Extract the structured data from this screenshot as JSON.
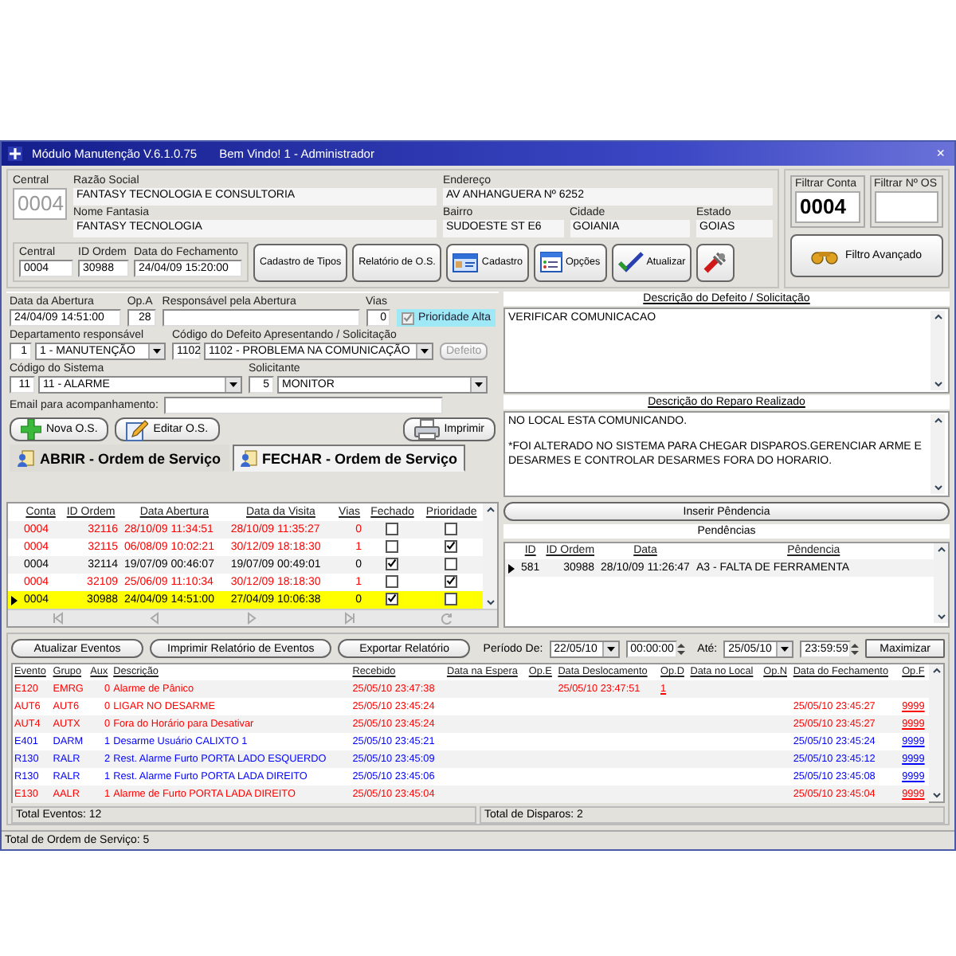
{
  "window": {
    "title": "Módulo Manutenção V.6.1.0.75",
    "welcome": "Bem Vindo! 1 - Administrador",
    "close": "×"
  },
  "client": {
    "central": {
      "label": "Central",
      "value": "0004",
      "disabled": true
    },
    "razao_social": {
      "label": "Razão Social",
      "value": "FANTASY TECNOLOGIA E CONSULTORIA"
    },
    "nome_fantasia": {
      "label": "Nome Fantasia",
      "value": "FANTASY TECNOLOGIA"
    },
    "endereco": {
      "label": "Endereço",
      "value": "AV ANHANGUERA  Nº 6252"
    },
    "bairro": {
      "label": "Bairro",
      "value": "SUDOESTE ST E6"
    },
    "cidade": {
      "label": "Cidade",
      "value": "GOIANIA"
    },
    "estado": {
      "label": "Estado",
      "value": "GOIAS"
    }
  },
  "order": {
    "central": {
      "label": "Central",
      "value": "0004"
    },
    "id_ordem": {
      "label": "ID Ordem",
      "value": "30988"
    },
    "data_fechamento": {
      "label": "Data do Fechamento",
      "value": "24/04/09 15:20:00"
    }
  },
  "toolbar": [
    {
      "kind": "text",
      "label": "Cadastro de Tipos"
    },
    {
      "kind": "text",
      "label": "Relatório de O.S."
    },
    {
      "kind": "card",
      "label": "Cadastro"
    },
    {
      "kind": "options",
      "label": "Opções"
    },
    {
      "kind": "check",
      "label": "Atualizar"
    },
    {
      "kind": "tools"
    }
  ],
  "filters": {
    "conta": {
      "label": "Filtrar Conta",
      "value": "0004"
    },
    "os": {
      "label": "Filtrar Nº OS"
    },
    "advanced": "Filtro Avançado"
  },
  "form": {
    "data_abertura": {
      "label": "Data da Abertura",
      "value": "24/04/09 14:51:00"
    },
    "op_a": {
      "label": "Op.A",
      "value": "28"
    },
    "responsavel": {
      "label": "Responsável pela Abertura"
    },
    "vias": {
      "label": "Vias",
      "value": "0"
    },
    "prioridade": {
      "label": "Prioridade Alta",
      "checked": true,
      "disabled": true
    },
    "departamento": {
      "label": "Departamento responsável",
      "code": "1",
      "value": "1 - MANUTENÇÃO"
    },
    "defeito": {
      "label": "Código do Defeito Apresentando / Solicitação",
      "code": "1102",
      "value": "1102 - PROBLEMA NA COMUNICAÇÃO"
    },
    "defeito_button": {
      "label": "Defeito",
      "disabled": true
    },
    "sistema": {
      "label": "Código do Sistema",
      "code": "11",
      "value": "11 - ALARME"
    },
    "solicitante": {
      "label": "Solicitante",
      "code": "5",
      "value": "MONITOR"
    },
    "email": {
      "label": "Email para acompanhamento:"
    },
    "actions": [
      {
        "kind": "new",
        "label": "Nova O.S."
      },
      {
        "kind": "edit",
        "label": "Editar O.S."
      },
      {
        "kind": "print",
        "label": "Imprimir"
      }
    ]
  },
  "tabs": [
    {
      "label": "ABRIR - Ordem de Serviço",
      "selected": false
    },
    {
      "label": "FECHAR - Ordem de Serviço",
      "selected": true
    }
  ],
  "defect_description": {
    "label": "Descrição do Defeito / Solicitação",
    "text": "VERIFICAR COMUNICACAO"
  },
  "repair_description": {
    "label": "Descrição do Reparo Realizado",
    "paragraphs": [
      "NO LOCAL ESTA COMUNICANDO.",
      "*FOI ALTERADO NO SISTEMA PARA CHEGAR DISPAROS.GERENCIAR ARME E DESARMES E CONTROLAR DESARMES FORA DO HORARIO."
    ]
  },
  "orders": {
    "columns": [
      "Conta",
      "ID Ordem",
      "Data Abertura",
      "Data da Visita",
      "Vias",
      "Fechado",
      "Prioridade"
    ],
    "rows": [
      {
        "conta": "0004",
        "id": "32116",
        "abertura": "28/10/09 11:34:51",
        "visita": "28/10/09 11:35:27",
        "vias": "0",
        "fechado": false,
        "prioridade": false,
        "color": "#ff0000",
        "selected": false
      },
      {
        "conta": "0004",
        "id": "32115",
        "abertura": "06/08/09 10:02:21",
        "visita": "30/12/09 18:18:30",
        "vias": "1",
        "fechado": false,
        "prioridade": true,
        "color": "#ff0000",
        "selected": false
      },
      {
        "conta": "0004",
        "id": "32114",
        "abertura": "19/07/09 00:46:07",
        "visita": "19/07/09 00:49:01",
        "vias": "0",
        "fechado": true,
        "prioridade": false,
        "color": "#000000",
        "selected": false
      },
      {
        "conta": "0004",
        "id": "32109",
        "abertura": "25/06/09 11:10:34",
        "visita": "30/12/09 18:18:30",
        "vias": "1",
        "fechado": false,
        "prioridade": true,
        "color": "#ff0000",
        "selected": false
      },
      {
        "conta": "0004",
        "id": "30988",
        "abertura": "24/04/09 14:51:00",
        "visita": "27/04/09 10:06:38",
        "vias": "0",
        "fechado": true,
        "prioridade": false,
        "color": "#000000",
        "selected": true
      }
    ]
  },
  "pendencias": {
    "button": "Inserir Pêndencia",
    "title": "Pendências",
    "columns": [
      "ID",
      "ID Ordem",
      "Data",
      "Pêndencia"
    ],
    "rows": [
      {
        "id": "581",
        "ordem": "30988",
        "data": "28/10/09 11:26:47",
        "pendencia": "A3 - FALTA DE FERRAMENTA",
        "selected": true
      }
    ]
  },
  "events": {
    "buttons": [
      "Atualizar Eventos",
      "Imprimir Relatório de Eventos",
      "Exportar Relatório"
    ],
    "period": {
      "from_label": "Período De:",
      "from_date": "22/05/10",
      "from_time": "00:00:00",
      "to_label": "Até:",
      "to_date": "25/05/10",
      "to_time": "23:59:59"
    },
    "maximize": "Maximizar",
    "columns": [
      "Evento",
      "Grupo",
      "Aux",
      "Descrição",
      "Recebido",
      "Data na Espera",
      "Op.E",
      "Data Deslocamento",
      "Op.D",
      "Data no Local",
      "Op.N",
      "Data do Fechamento",
      "Op.F"
    ],
    "rows": [
      {
        "evento": "E120",
        "grupo": "EMRG",
        "aux": "0",
        "descricao": "Alarme de Pânico",
        "recebido": "25/05/10 23:47:38",
        "deslocamento": "25/05/10 23:47:51",
        "op_d": "1",
        "color": "#ff0000"
      },
      {
        "evento": "AUT6",
        "grupo": "AUT6",
        "aux": "0",
        "descricao": "LIGAR NO DESARME",
        "recebido": "25/05/10 23:45:24",
        "fechamento": "25/05/10 23:45:27",
        "op_f": "9999",
        "color": "#ff0000"
      },
      {
        "evento": "AUT4",
        "grupo": "AUTX",
        "aux": "0",
        "descricao": "Fora do Horário para Desativar",
        "recebido": "25/05/10 23:45:24",
        "fechamento": "25/05/10 23:45:27",
        "op_f": "9999",
        "color": "#ff0000"
      },
      {
        "evento": "E401",
        "grupo": "DARM",
        "aux": "1",
        "descricao": "Desarme Usuário CALIXTO 1",
        "recebido": "25/05/10 23:45:21",
        "fechamento": "25/05/10 23:45:24",
        "op_f": "9999",
        "color": "#0000ff"
      },
      {
        "evento": "R130",
        "grupo": "RALR",
        "aux": "2",
        "descricao": "Rest. Alarme Furto PORTA LADO ESQUERDO",
        "recebido": "25/05/10 23:45:09",
        "fechamento": "25/05/10 23:45:12",
        "op_f": "9999",
        "color": "#0000ff"
      },
      {
        "evento": "R130",
        "grupo": "RALR",
        "aux": "1",
        "descricao": "Rest. Alarme Furto PORTA LADA DIREITO",
        "recebido": "25/05/10 23:45:06",
        "fechamento": "25/05/10 23:45:08",
        "op_f": "9999",
        "color": "#0000ff"
      },
      {
        "evento": "E130",
        "grupo": "AALR",
        "aux": "1",
        "descricao": "Alarme de Furto PORTA LADA DIREITO",
        "recebido": "25/05/10 23:45:04",
        "fechamento": "25/05/10 23:45:04",
        "op_f": "9999",
        "color": "#ff0000"
      }
    ],
    "total_eventos": "Total Eventos: 12",
    "total_disparos": "Total de Disparos: 2"
  },
  "status_bar": "Total de Ordem de Serviço: 5"
}
